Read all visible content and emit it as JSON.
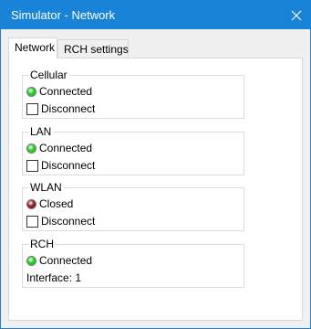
{
  "window": {
    "title": "Simulator - Network"
  },
  "tabs": [
    {
      "label": "Network",
      "active": true
    },
    {
      "label": "RCH settings",
      "active": false
    }
  ],
  "groups": {
    "cellular": {
      "title": "Cellular",
      "status": "Connected",
      "status_color": "#1fd01f",
      "action": "Disconnect",
      "checked": false
    },
    "lan": {
      "title": "LAN",
      "status": "Connected",
      "status_color": "#1fd01f",
      "action": "Disconnect",
      "checked": false
    },
    "wlan": {
      "title": "WLAN",
      "status": "Closed",
      "status_color": "#8b1a1a",
      "action": "Disconnect",
      "checked": false
    },
    "rch": {
      "title": "RCH",
      "status": "Connected",
      "status_color": "#1fd01f",
      "interface": "Interface: 1"
    }
  },
  "icons": {
    "close": "close-icon",
    "status": "status-led-icon"
  },
  "colors": {
    "titlebar": "#1883d7",
    "connected": "#1fd01f",
    "closed": "#8b1a1a"
  }
}
